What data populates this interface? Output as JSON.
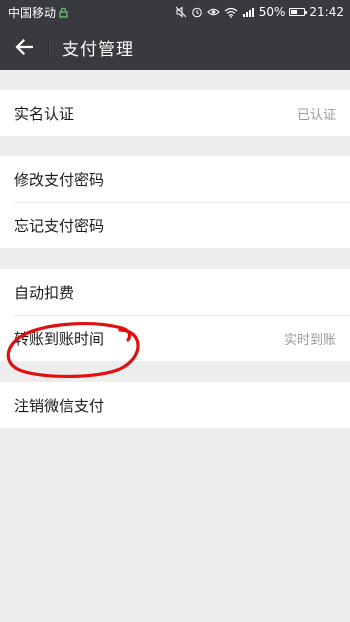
{
  "status_bar": {
    "carrier": "中国移动",
    "battery_percent": "50%",
    "time": "21:42",
    "icons": [
      "lock-icon",
      "mute-icon",
      "alarm-icon",
      "eye-icon",
      "wifi-icon",
      "signal-icon",
      "battery-icon"
    ]
  },
  "header": {
    "title": "支付管理",
    "back_icon": "back-arrow-icon"
  },
  "groups": [
    {
      "items": [
        {
          "label": "实名认证",
          "value": "已认证"
        }
      ]
    },
    {
      "items": [
        {
          "label": "修改支付密码"
        },
        {
          "label": "忘记支付密码"
        }
      ]
    },
    {
      "items": [
        {
          "label": "自动扣费"
        },
        {
          "label": "转账到账时间",
          "value": "实时到账"
        }
      ]
    },
    {
      "items": [
        {
          "label": "注销微信支付"
        }
      ]
    }
  ],
  "colors": {
    "header_bg": "#393a3f",
    "page_bg": "#ededed",
    "annotation_circle": "#e01010"
  }
}
